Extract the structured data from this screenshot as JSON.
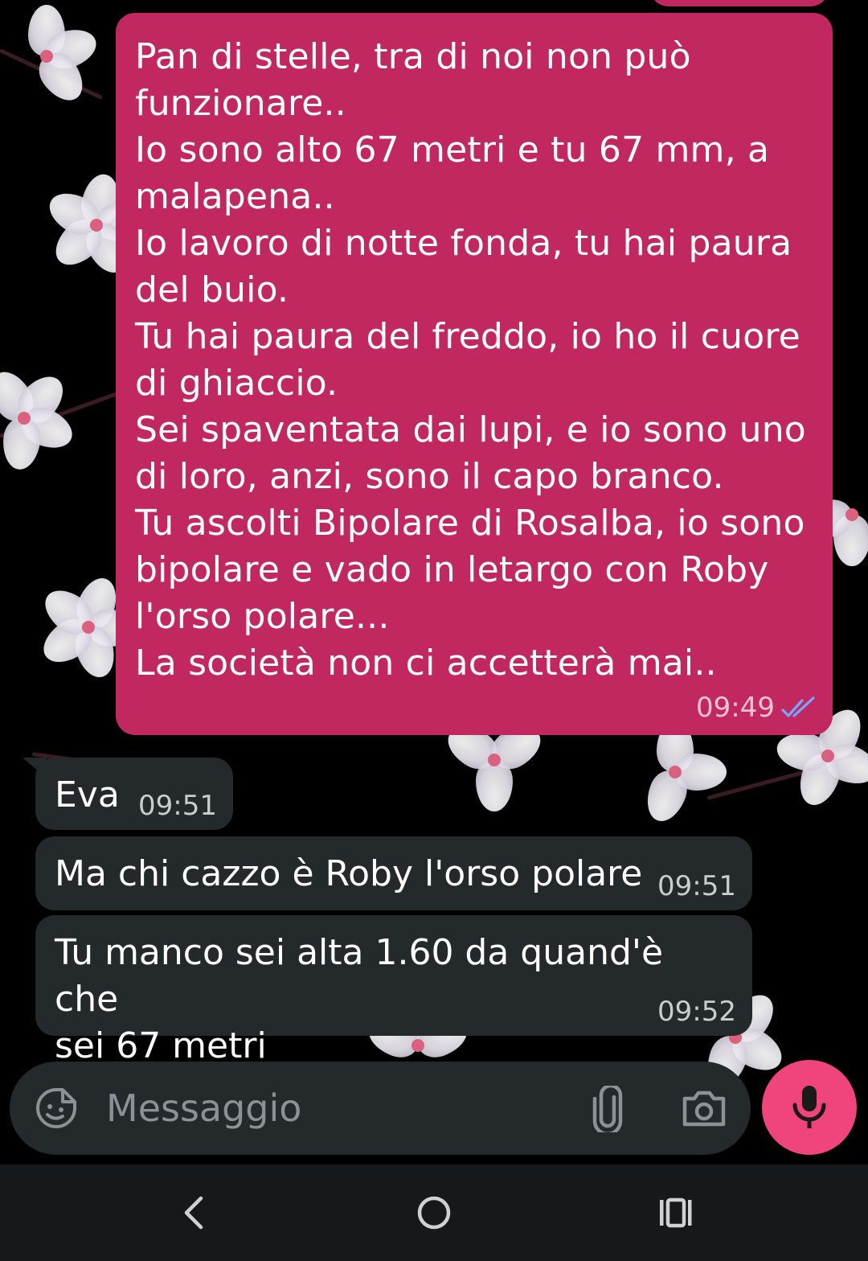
{
  "conversation": {
    "messages": [
      {
        "direction": "outgoing",
        "text": "Pan di stelle, tra di noi non può\nfunzionare..\nIo sono alto 67 metri e tu 67 mm, a\nmalapena..\nIo lavoro di notte fonda, tu hai paura\ndel buio.\nTu hai paura del freddo, io ho il cuore\ndi ghiaccio.\nSei spaventata dai lupi, e io sono uno\ndi loro, anzi, sono il capo branco.\nTu ascolti Bipolare di Rosalba, io sono\nbipolare e vado in letargo con Roby\nl'orso polare...\nLa società non ci accetterà mai..",
        "time": "09:49",
        "status": "read"
      },
      {
        "direction": "incoming",
        "text": "Eva",
        "time": "09:51"
      },
      {
        "direction": "incoming",
        "text": "Ma chi cazzo è Roby l'orso polare",
        "time": "09:51"
      },
      {
        "direction": "incoming",
        "text": "Tu manco sei alta 1.60 da quand'è che\nsei 67 metri",
        "time": "09:52"
      }
    ]
  },
  "composer": {
    "placeholder": "Messaggio",
    "emoji_icon": "sticker-emoji-icon",
    "attach_icon": "paperclip-icon",
    "camera_icon": "camera-icon",
    "mic_icon": "microphone-icon"
  },
  "navigation": {
    "back_icon": "chevron-left-icon",
    "home_icon": "circle-home-icon",
    "recents_icon": "recents-bars-icon"
  },
  "colors": {
    "outgoing_bubble": "#c0285f",
    "incoming_bubble": "#24292c",
    "mic_button": "#f0447c",
    "read_ticks": "#7aa6ff"
  }
}
